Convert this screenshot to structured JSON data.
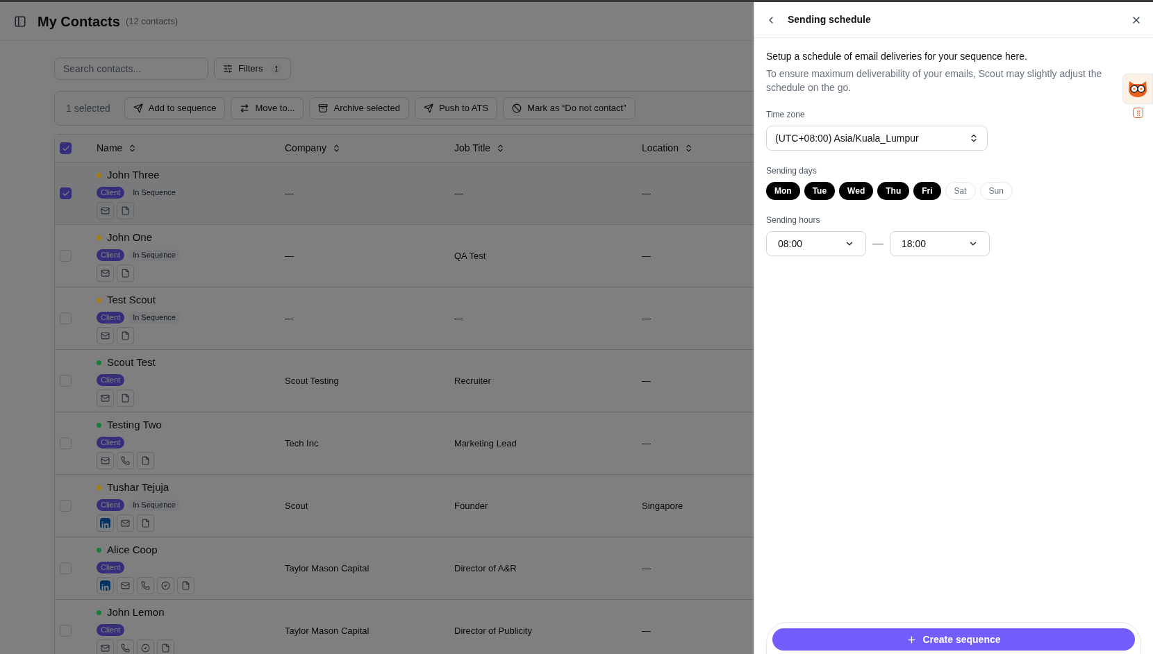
{
  "header": {
    "title": "My Contacts",
    "count": "(12 contacts)"
  },
  "search": {
    "placeholder": "Search contacts..."
  },
  "filters": {
    "label": "Filters",
    "count": "1"
  },
  "bulk_bar": {
    "selected_text": "1 selected",
    "actions": [
      {
        "kind": "send",
        "label": "Add to sequence"
      },
      {
        "kind": "move",
        "label": "Move to..."
      },
      {
        "kind": "archive",
        "label": "Archive selected"
      },
      {
        "kind": "push",
        "label": "Push to ATS"
      },
      {
        "kind": "block",
        "label": "Mark as “Do not contact”"
      }
    ]
  },
  "table": {
    "all_checked": true,
    "columns": [
      "Name",
      "Company",
      "Job Title",
      "Location"
    ],
    "rows": [
      {
        "name": "John Three",
        "color": "#a87c0c",
        "selected": true,
        "tags": [
          "Client",
          "In Sequence"
        ],
        "channels": [
          {
            "kind": "email"
          },
          {
            "kind": "file"
          }
        ],
        "company": "—",
        "job_title": "—",
        "location": "—"
      },
      {
        "name": "John One",
        "color": "#a87c0c",
        "selected": false,
        "tags": [
          "Client",
          "In Sequence"
        ],
        "channels": [
          {
            "kind": "email"
          },
          {
            "kind": "file"
          }
        ],
        "company": "—",
        "job_title": "QA Test",
        "location": "—"
      },
      {
        "name": "Test Scout",
        "color": "#a87c0c",
        "selected": false,
        "tags": [
          "Client",
          "In Sequence"
        ],
        "channels": [
          {
            "kind": "email"
          },
          {
            "kind": "file"
          }
        ],
        "company": "—",
        "job_title": "—",
        "location": "—"
      },
      {
        "name": "Scout Test",
        "color": "#157f3a",
        "selected": false,
        "tags": [
          "Client"
        ],
        "channels": [
          {
            "kind": "email"
          },
          {
            "kind": "file"
          }
        ],
        "company": "Scout Testing",
        "job_title": "Recruiter",
        "location": "—"
      },
      {
        "name": "Testing Two",
        "color": "#157f3a",
        "selected": false,
        "tags": [
          "Client"
        ],
        "channels": [
          {
            "kind": "email"
          },
          {
            "kind": "phone"
          },
          {
            "kind": "file"
          }
        ],
        "company": "Tech Inc",
        "job_title": "Marketing Lead",
        "location": "—"
      },
      {
        "name": "Tushar Tejuja",
        "color": "#a87c0c",
        "selected": false,
        "tags": [
          "Client",
          "In Sequence"
        ],
        "channels": [
          {
            "kind": "linkedin"
          },
          {
            "kind": "email"
          },
          {
            "kind": "file"
          }
        ],
        "company": "Scout",
        "job_title": "Founder",
        "location": "Singapore"
      },
      {
        "name": "Alice Coop",
        "color": "#157f3a",
        "selected": false,
        "tags": [
          "Client"
        ],
        "channels": [
          {
            "kind": "linkedin"
          },
          {
            "kind": "email"
          },
          {
            "kind": "phone"
          },
          {
            "kind": "check"
          },
          {
            "kind": "file"
          }
        ],
        "company": "Taylor Mason Capital",
        "job_title": "Director of A&R",
        "location": "—"
      },
      {
        "name": "John Lemon",
        "color": "#157f3a",
        "selected": false,
        "tags": [
          "Client"
        ],
        "channels": [
          {
            "kind": "email"
          },
          {
            "kind": "phone"
          },
          {
            "kind": "check"
          },
          {
            "kind": "file"
          }
        ],
        "company": "Taylor Mason Capital",
        "job_title": "Director of Publicity",
        "location": "—"
      }
    ]
  },
  "panel": {
    "title": "Sending schedule",
    "intro": "Setup a schedule of email deliveries for your sequence here.",
    "note": "To ensure maximum deliverability of your emails, Scout may slightly adjust the schedule on the go.",
    "timezone": {
      "label": "Time zone",
      "value": "(UTC+08:00) Asia/Kuala_Lumpur"
    },
    "days": {
      "label": "Sending days",
      "items": [
        {
          "label": "Mon",
          "selected": true
        },
        {
          "label": "Tue",
          "selected": true
        },
        {
          "label": "Wed",
          "selected": true
        },
        {
          "label": "Thu",
          "selected": true
        },
        {
          "label": "Fri",
          "selected": true
        },
        {
          "label": "Sat",
          "selected": false
        },
        {
          "label": "Sun",
          "selected": false
        }
      ]
    },
    "hours": {
      "label": "Sending hours",
      "from": "08:00",
      "separator": "—",
      "to": "18:00"
    },
    "create_button": "Create sequence"
  }
}
